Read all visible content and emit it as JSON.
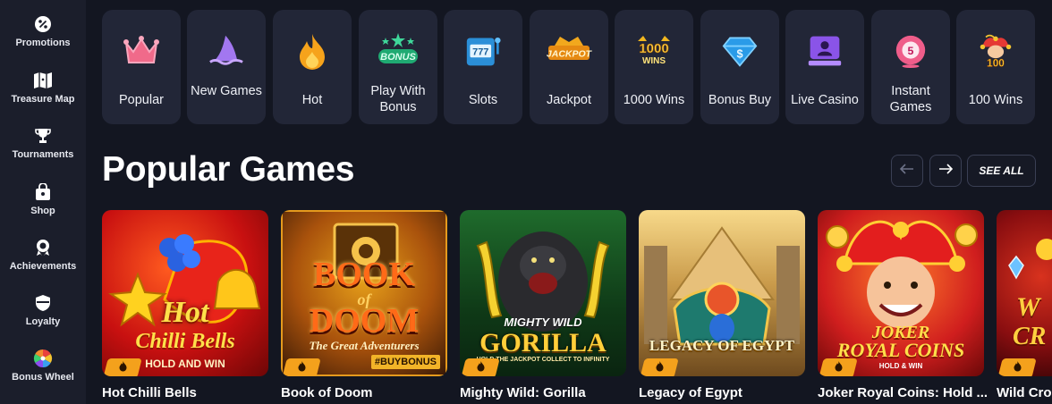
{
  "sidebar": {
    "items": [
      {
        "label": "Promotions",
        "icon": "percent-icon"
      },
      {
        "label": "Treasure Map",
        "icon": "map-icon"
      },
      {
        "label": "Tournaments",
        "icon": "trophy-icon"
      },
      {
        "label": "Shop",
        "icon": "shopping-bag-icon"
      },
      {
        "label": "Achievements",
        "icon": "medal-icon"
      },
      {
        "label": "Loyalty",
        "icon": "shield-icon"
      },
      {
        "label": "Bonus Wheel",
        "icon": "wheel-icon"
      }
    ]
  },
  "categories": [
    {
      "label": "Popular",
      "icon": "crown-icon"
    },
    {
      "label": "New Games",
      "icon": "shark-fin-icon"
    },
    {
      "label": "Hot",
      "icon": "flame-icon"
    },
    {
      "label": "Play With Bonus",
      "icon": "bonus-badge-icon",
      "badge": "BONUS"
    },
    {
      "label": "Slots",
      "icon": "slot-machine-icon",
      "badge": "777"
    },
    {
      "label": "Jackpot",
      "icon": "jackpot-icon",
      "badge": "JACKPOT"
    },
    {
      "label": "1000 Wins",
      "icon": "thousand-wins-icon",
      "badge": "1000",
      "badge2": "WINS"
    },
    {
      "label": "Bonus Buy",
      "icon": "diamond-dollar-icon"
    },
    {
      "label": "Live Casino",
      "icon": "live-dealer-icon"
    },
    {
      "label": "Instant Games",
      "icon": "instant-ball-icon"
    },
    {
      "label": "100 Wins",
      "icon": "jester-icon",
      "badge": "100"
    }
  ],
  "section": {
    "title": "Popular Games",
    "see_all": "SEE ALL",
    "prev_icon": "arrow-left-icon",
    "next_icon": "arrow-right-icon"
  },
  "games": [
    {
      "name": "Hot Chilli Bells",
      "art_line1": "Hot",
      "art_line2": "Chilli Bells",
      "art_line3": "HOLD AND WIN"
    },
    {
      "name": "Book of Doom",
      "art_line1": "BOOK",
      "art_line2": "of",
      "art_line3": "DOOM",
      "art_line4": "The Great Adventurers",
      "art_line5": "#BUYBONUS"
    },
    {
      "name": "Mighty Wild: Gorilla",
      "art_line1": "MIGHTY WILD",
      "art_line2": "GORILLA",
      "art_line3": "HOLD THE JACKPOT COLLECT TO INFINITY"
    },
    {
      "name": "Legacy of Egypt",
      "art_line1": "LEGACY OF EGYPT"
    },
    {
      "name": "Joker Royal Coins: Hold ...",
      "art_line1": "JOKER",
      "art_line2": "ROYAL COINS",
      "art_line3": "HOLD & WIN"
    },
    {
      "name": "Wild Cro",
      "art_line1": "W",
      "art_line2": "CR"
    }
  ],
  "colors": {
    "background": "#131621",
    "sidebar": "#1b1e2b",
    "tile": "#222637",
    "hot_badge": "#f4a11c"
  }
}
